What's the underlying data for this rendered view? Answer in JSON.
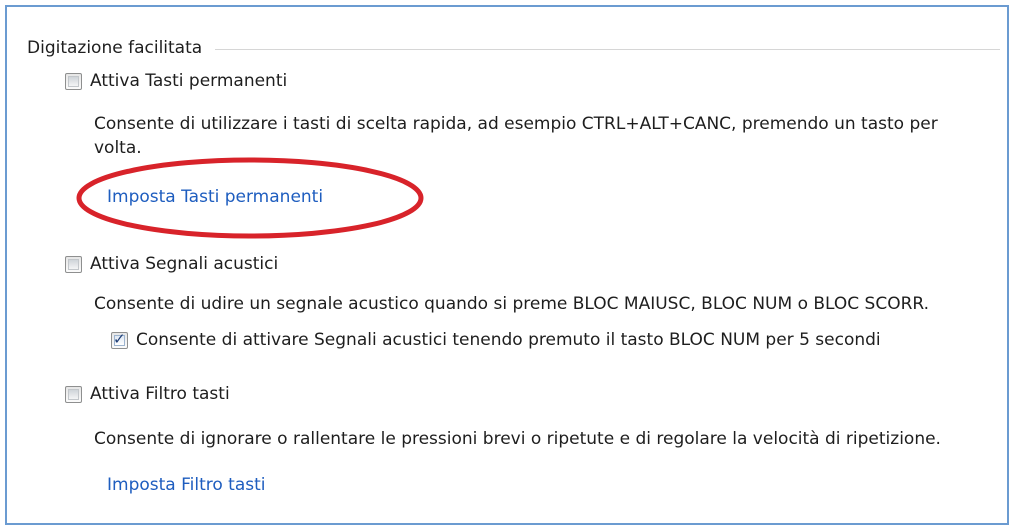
{
  "section": {
    "title": "Digitazione facilitata"
  },
  "sticky_keys": {
    "checkbox_label": "Attiva Tasti permanenti",
    "checked": false,
    "description_line1": "Consente di utilizzare i tasti di scelta rapida, ad esempio CTRL+ALT+CANC, premendo un tasto per",
    "description_line2": "volta.",
    "link": "Imposta Tasti permanenti"
  },
  "toggle_keys": {
    "checkbox_label": "Attiva Segnali acustici",
    "checked": false,
    "description": "Consente di udire un segnale acustico quando si preme BLOC MAIUSC, BLOC NUM o BLOC SCORR.",
    "sub_option_label": "Consente di attivare Segnali acustici tenendo premuto il tasto BLOC NUM per 5 secondi",
    "sub_option_checked": true
  },
  "filter_keys": {
    "checkbox_label": "Attiva Filtro tasti",
    "checked": false,
    "description": "Consente di ignorare o rallentare le pressioni brevi o ripetute e di regolare la velocità di ripetizione.",
    "link": "Imposta Filtro tasti"
  },
  "colors": {
    "link": "#1e5dbf",
    "highlight_ellipse": "#d8232a",
    "frame_border": "#6b9bd1"
  }
}
